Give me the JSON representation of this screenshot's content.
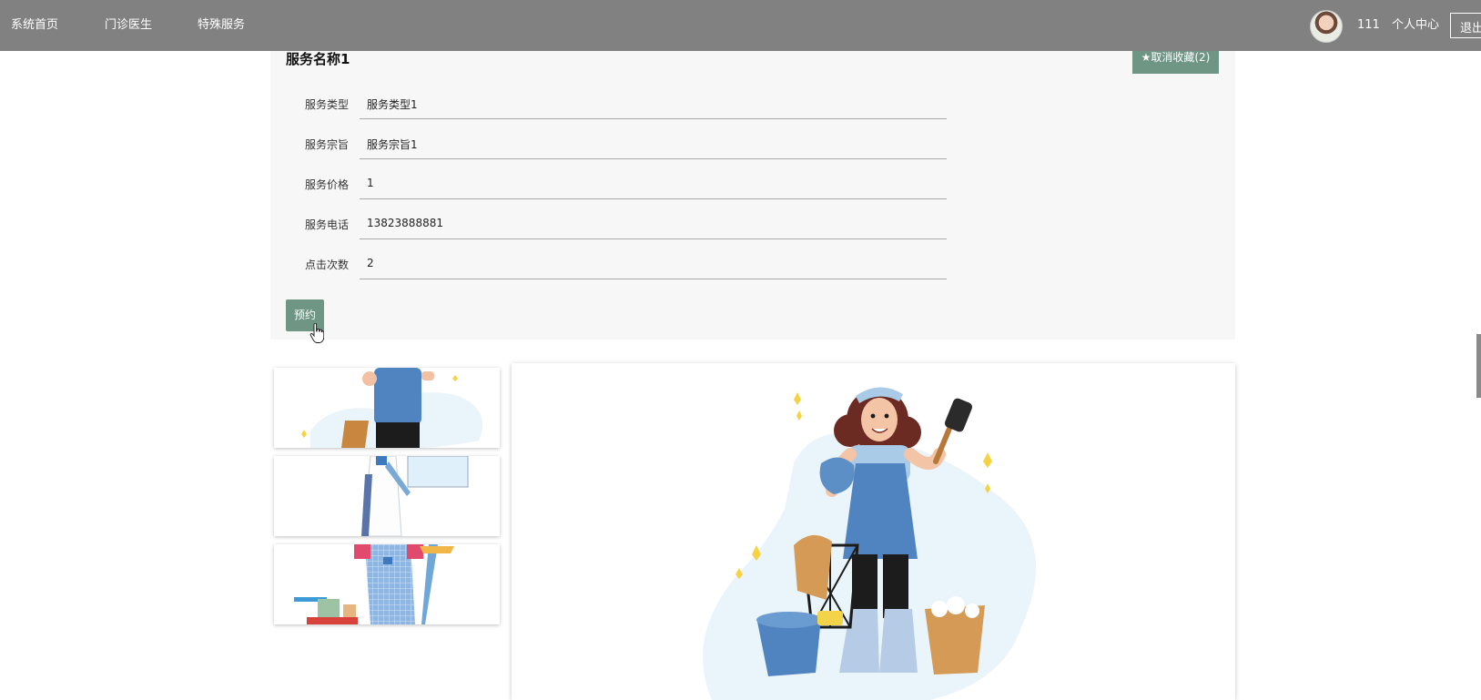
{
  "nav": {
    "items": [
      {
        "label": "系统首页"
      },
      {
        "label": "门诊医生"
      },
      {
        "label": "特殊服务"
      }
    ],
    "username": "111",
    "personal_center": "个人中心",
    "logout": "退出"
  },
  "service": {
    "title": "服务名称1",
    "favorite_label": "★取消收藏(2)",
    "fields": [
      {
        "label": "服务类型",
        "value": "服务类型1"
      },
      {
        "label": "服务宗旨",
        "value": "服务宗旨1"
      },
      {
        "label": "服务价格",
        "value": "1"
      },
      {
        "label": "服务电话",
        "value": "13823888881"
      },
      {
        "label": "点击次数",
        "value": "2"
      }
    ],
    "reserve_label": "预约"
  },
  "colors": {
    "nav_bg": "#818181",
    "accent": "#6f9585",
    "panel_bg": "#f7f7f7"
  },
  "icons": {
    "cursor": "hand-pointer-icon",
    "avatar": "user-avatar"
  }
}
